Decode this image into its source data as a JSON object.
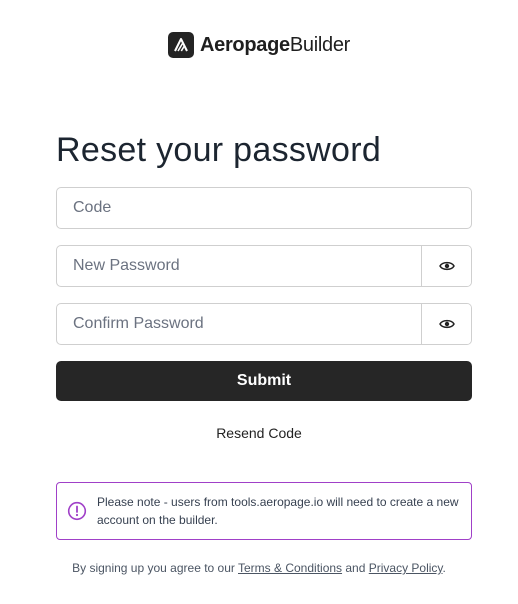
{
  "brand": {
    "name_bold": "Aeropage",
    "name_light": "Builder",
    "logo_icon": "aeropage-logo-icon"
  },
  "page": {
    "title": "Reset your password"
  },
  "form": {
    "code": {
      "placeholder": "Code",
      "value": ""
    },
    "new_password": {
      "placeholder": "New Password",
      "value": "",
      "toggle_icon": "eye-icon"
    },
    "confirm_password": {
      "placeholder": "Confirm Password",
      "value": "",
      "toggle_icon": "eye-icon"
    },
    "submit_label": "Submit",
    "resend_label": "Resend Code"
  },
  "notice": {
    "icon": "alert-circle-icon",
    "text": "Please note - users from tools.aeropage.io will need to create a new account on the builder.",
    "border_color": "#a040c8"
  },
  "footer": {
    "prefix": "By signing up you agree to our ",
    "terms_link": "Terms & Conditions",
    "middle": " and ",
    "privacy_link": "Privacy Policy",
    "suffix": "."
  },
  "colors": {
    "primary_button": "#262626",
    "accent": "#a040c8"
  }
}
